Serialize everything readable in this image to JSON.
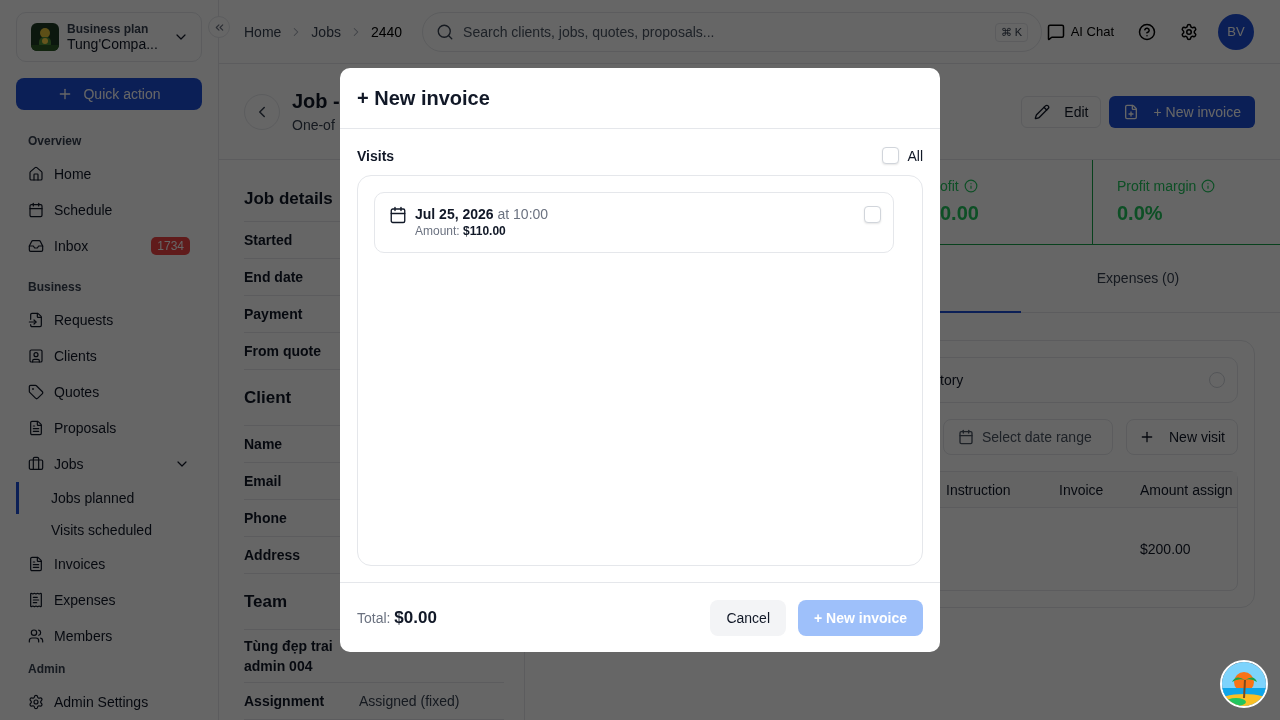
{
  "workspace": {
    "plan": "Business plan",
    "name": "Tung'Compa..."
  },
  "quick_action": "Quick action",
  "sidebar": {
    "sections": [
      {
        "title": "Overview",
        "items": [
          {
            "label": "Home"
          },
          {
            "label": "Schedule"
          },
          {
            "label": "Inbox",
            "badge": "1734"
          }
        ]
      },
      {
        "title": "Business",
        "items": [
          {
            "label": "Requests"
          },
          {
            "label": "Clients"
          },
          {
            "label": "Quotes"
          },
          {
            "label": "Proposals"
          },
          {
            "label": "Jobs",
            "expanded": true,
            "children": [
              {
                "label": "Jobs planned",
                "selected": true
              },
              {
                "label": "Visits scheduled",
                "selected": false
              }
            ]
          },
          {
            "label": "Invoices"
          },
          {
            "label": "Expenses"
          },
          {
            "label": "Members"
          }
        ]
      }
    ],
    "admin": {
      "title": "Admin",
      "items": [
        {
          "label": "Admin Settings"
        }
      ]
    }
  },
  "breadcrumb": [
    "Home",
    "Jobs",
    "2440"
  ],
  "search": {
    "placeholder": "Search clients, jobs, quotes, proposals...",
    "shortcut": "⌘ K"
  },
  "ai_chat": "AI Chat",
  "avatar": "BV",
  "page_header": {
    "title": "Job -",
    "subtitle": "One-of",
    "edit": "Edit",
    "new_invoice": "+ New invoice"
  },
  "details": [
    {
      "title": "Job details",
      "rows": [
        {
          "label": "Started"
        },
        {
          "label": "End date"
        },
        {
          "label": "Payment"
        },
        {
          "label": "From quote"
        }
      ]
    },
    {
      "title": "Client",
      "rows": [
        {
          "label": "Name"
        },
        {
          "label": "Email"
        },
        {
          "label": "Phone"
        },
        {
          "label": "Address"
        }
      ]
    },
    {
      "title": "Team",
      "rows": [
        {
          "label": "Tùng đẹp trai admin 004"
        },
        {
          "label": "Assignment",
          "value": "Assigned (fixed)"
        }
      ]
    }
  ],
  "stats": [
    {
      "label": "ofit",
      "value": "0.00"
    },
    {
      "label": "Profit margin",
      "value": "0.0%"
    }
  ],
  "tabs": [
    {
      "label": "Expenses (0)",
      "selected": false
    }
  ],
  "visits_panel": {
    "history_label": "tory",
    "history_selected": false,
    "date_range_placeholder": "Select date range",
    "new_visit": "New visit",
    "columns": [
      "Instruction",
      "Invoice",
      "Amount assign"
    ],
    "rows": [
      {
        "amount": "$200.00"
      }
    ]
  },
  "modal": {
    "title": "+ New invoice",
    "visits_label": "Visits",
    "all": {
      "label": "All",
      "checked": false
    },
    "visits": [
      {
        "date": "Jul 25, 2026",
        "time": "at 10:00",
        "amount_label": "Amount:",
        "amount": "$110.00",
        "checked": false
      }
    ],
    "total_label": "Total:",
    "total": "$0.00",
    "cancel": "Cancel",
    "submit": {
      "label": "+ New invoice",
      "disabled": true
    }
  }
}
